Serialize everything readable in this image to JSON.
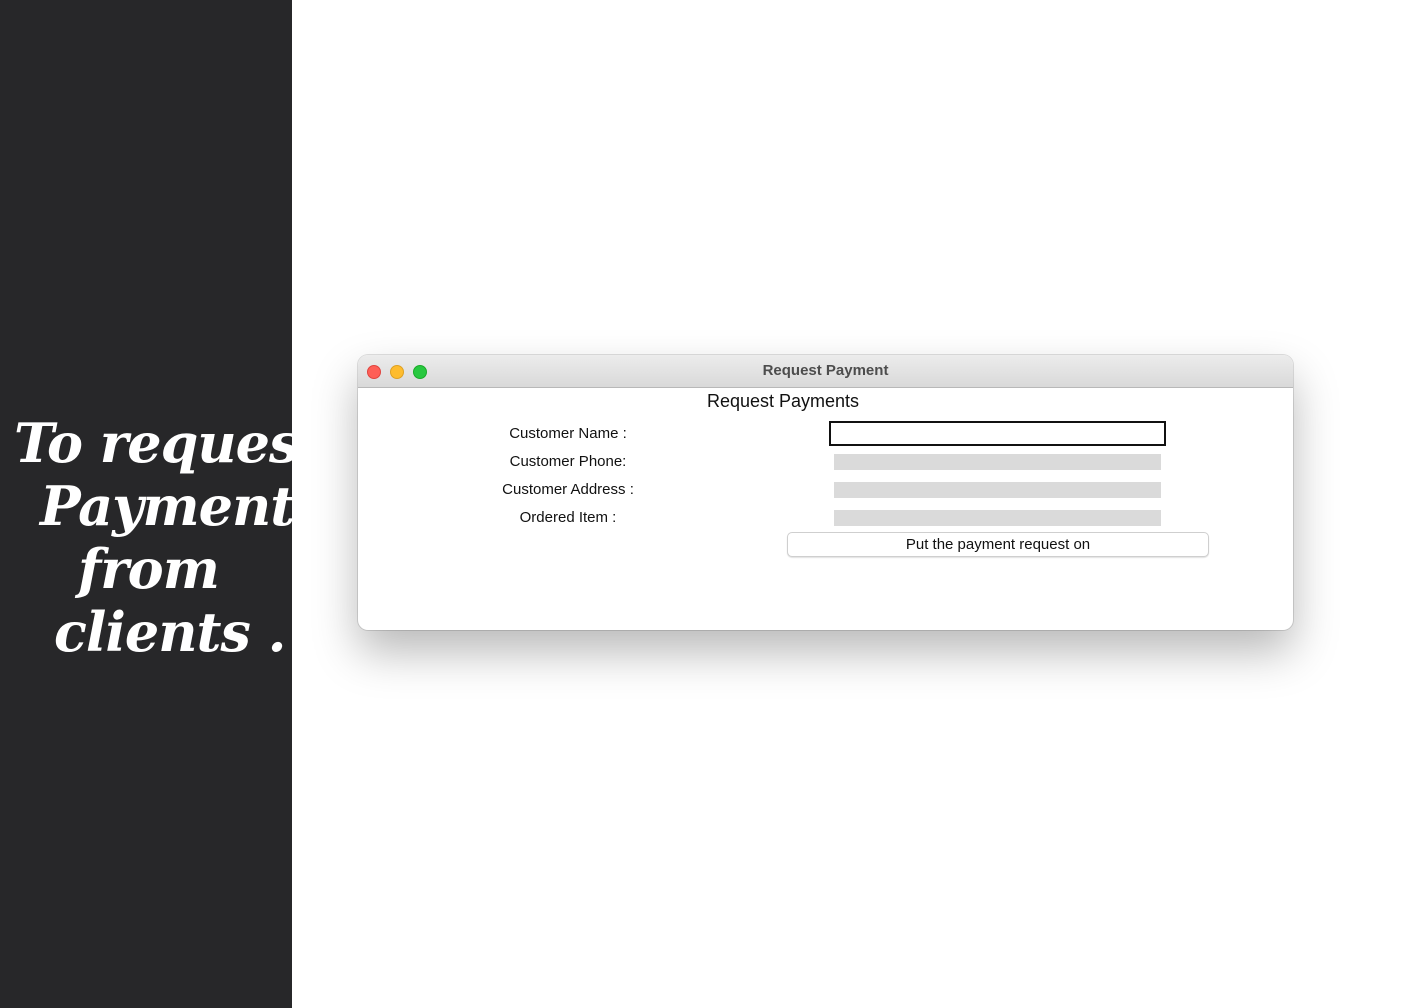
{
  "promo": {
    "tagline_lines": [
      "To request",
      "Payment",
      "from",
      "clients ."
    ]
  },
  "window": {
    "title": "Request Payment",
    "controls": {
      "close": "close",
      "minimize": "minimize",
      "zoom": "zoom"
    }
  },
  "form": {
    "heading": "Request Payments",
    "fields": [
      {
        "label": "Customer Name :",
        "value": "",
        "focused": true
      },
      {
        "label": "Customer Phone:",
        "value": "",
        "focused": false
      },
      {
        "label": "Customer Address :",
        "value": "",
        "focused": false
      },
      {
        "label": "Ordered Item :",
        "value": "",
        "focused": false
      }
    ],
    "submit_label": "Put the payment request on"
  },
  "colors": {
    "side_panel": "#272729",
    "close": "#fe5f57",
    "minimize": "#febc2e",
    "zoom": "#28c840",
    "input_fill": "#dadada"
  }
}
